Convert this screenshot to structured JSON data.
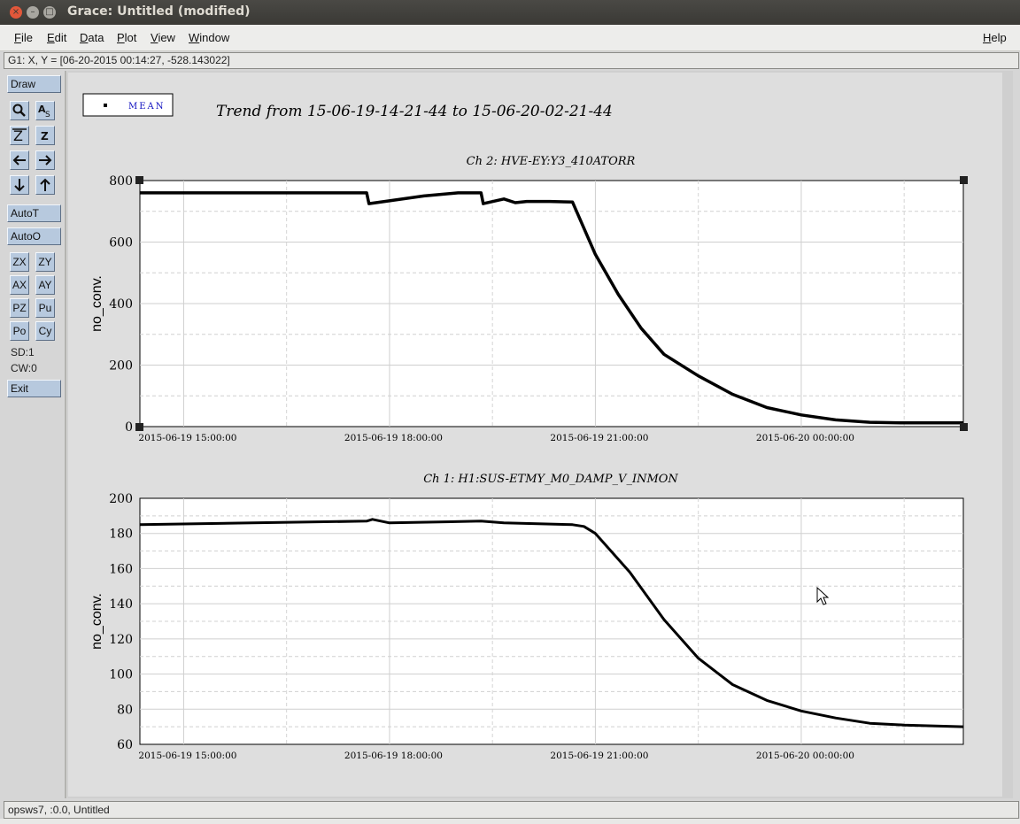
{
  "window": {
    "title": "Grace: Untitled (modified)"
  },
  "menu": {
    "file": "File",
    "edit": "Edit",
    "data": "Data",
    "plot": "Plot",
    "view": "View",
    "window": "Window",
    "help": "Help"
  },
  "locator": "G1: X, Y = [06-20-2015 00:14:27, -528.143022]",
  "tools": {
    "draw": "Draw",
    "autot": "AutoT",
    "autoo": "AutoO",
    "zx": "ZX",
    "zy": "ZY",
    "ax": "AX",
    "ay": "AY",
    "pz": "PZ",
    "pu": "Pu",
    "po": "Po",
    "cy": "Cy",
    "sd": "SD:1",
    "cw": "CW:0",
    "exit": "Exit"
  },
  "legend": {
    "label": "MEAN"
  },
  "main_title": "Trend from 15-06-19-14-21-44 to 15-06-20-02-21-44",
  "status": "opsws7, :0.0, Untitled",
  "chart_data": [
    {
      "type": "line",
      "title": "Ch 2: HVE-EY:Y3_410ATORR",
      "ylabel": "no_conv.",
      "xlabel": "",
      "xlim": [
        "2015-06-19 14:21:44",
        "2015-06-20 02:21:44"
      ],
      "ylim": [
        0,
        800
      ],
      "yticks": [
        0,
        200,
        400,
        600,
        800
      ],
      "xticks": [
        "2015-06-19 15:00:00",
        "2015-06-19 18:00:00",
        "2015-06-19 21:00:00",
        "2015-06-20 00:00:00"
      ],
      "grid": true,
      "series": [
        {
          "name": "MEAN",
          "x": [
            "2015-06-19 14:21:44",
            "2015-06-19 15:00:00",
            "2015-06-19 16:00:00",
            "2015-06-19 17:00:00",
            "2015-06-19 17:40:00",
            "2015-06-19 17:42:00",
            "2015-06-19 18:30:00",
            "2015-06-19 19:00:00",
            "2015-06-19 19:20:00",
            "2015-06-19 19:22:00",
            "2015-06-19 19:40:00",
            "2015-06-19 19:50:00",
            "2015-06-19 20:00:00",
            "2015-06-19 20:20:00",
            "2015-06-19 20:40:00",
            "2015-06-19 21:00:00",
            "2015-06-19 21:20:00",
            "2015-06-19 21:40:00",
            "2015-06-19 22:00:00",
            "2015-06-19 22:30:00",
            "2015-06-19 23:00:00",
            "2015-06-19 23:30:00",
            "2015-06-20 00:00:00",
            "2015-06-20 00:30:00",
            "2015-06-20 01:00:00",
            "2015-06-20 01:30:00",
            "2015-06-20 02:21:44"
          ],
          "y": [
            760,
            760,
            760,
            760,
            760,
            725,
            750,
            760,
            760,
            725,
            740,
            728,
            732,
            732,
            730,
            560,
            430,
            320,
            235,
            165,
            105,
            62,
            38,
            22,
            14,
            12,
            12
          ]
        }
      ]
    },
    {
      "type": "line",
      "title": "Ch 1: H1:SUS-ETMY_M0_DAMP_V_INMON",
      "ylabel": "no_conv.",
      "xlabel": "",
      "xlim": [
        "2015-06-19 14:21:44",
        "2015-06-20 02:21:44"
      ],
      "ylim": [
        60,
        200
      ],
      "yticks": [
        60,
        80,
        100,
        120,
        140,
        160,
        180,
        200
      ],
      "xticks": [
        "2015-06-19 15:00:00",
        "2015-06-19 18:00:00",
        "2015-06-19 21:00:00",
        "2015-06-20 00:00:00"
      ],
      "grid": true,
      "series": [
        {
          "name": "MEAN",
          "x": [
            "2015-06-19 14:21:44",
            "2015-06-19 16:00:00",
            "2015-06-19 17:40:00",
            "2015-06-19 17:45:00",
            "2015-06-19 18:00:00",
            "2015-06-19 19:20:00",
            "2015-06-19 19:40:00",
            "2015-06-19 20:40:00",
            "2015-06-19 20:50:00",
            "2015-06-19 21:00:00",
            "2015-06-19 21:30:00",
            "2015-06-19 22:00:00",
            "2015-06-19 22:30:00",
            "2015-06-19 23:00:00",
            "2015-06-19 23:30:00",
            "2015-06-20 00:00:00",
            "2015-06-20 00:30:00",
            "2015-06-20 01:00:00",
            "2015-06-20 01:30:00",
            "2015-06-20 02:21:44"
          ],
          "y": [
            185,
            186,
            187,
            188,
            186,
            187,
            186,
            185,
            184,
            180,
            158,
            131,
            109,
            94,
            85,
            79,
            75,
            72,
            71,
            70
          ]
        }
      ]
    }
  ]
}
